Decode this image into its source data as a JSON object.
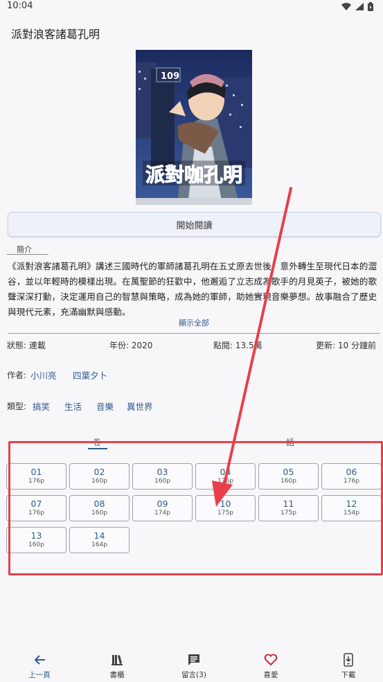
{
  "status": {
    "time": "10:04"
  },
  "title": "派對浪客諸葛孔明",
  "cover": {
    "overlay_text": "派對咖孔明",
    "badge": "109"
  },
  "read_button": "開始閱讀",
  "intro_tab": "簡介",
  "description": "《派對浪客諸葛孔明》講述三國時代的軍師諸葛孔明在五丈原去世後，意外轉生至現代日本的澀谷，並以年輕時的模樣出現。在萬聖節的狂歡中，他邂逅了立志成為歌手的月見英子，被她的歌聲深深打動，決定運用自己的智慧與策略，成為她的軍師，助她實現音樂夢想。故事融合了歷史與現代元素，充滿幽默與感動。",
  "show_all": "顯示全部",
  "info": {
    "status": "狀態: 連載",
    "year": "年份: 2020",
    "views": "點閱: 13.5萬",
    "updated": "更新: 10 分鐘前"
  },
  "author": {
    "label": "作者:",
    "names": [
      "小川亮",
      "四葉夕卜"
    ]
  },
  "genre": {
    "label": "類型:",
    "tags": [
      "搞笑",
      "生活",
      "音樂",
      "異世界"
    ]
  },
  "sections": {
    "volumes": "卷",
    "chapters": "話"
  },
  "chapters": [
    {
      "num": "01",
      "pages": "176p"
    },
    {
      "num": "02",
      "pages": "160p"
    },
    {
      "num": "03",
      "pages": "160p"
    },
    {
      "num": "04",
      "pages": "176p"
    },
    {
      "num": "05",
      "pages": "160p"
    },
    {
      "num": "06",
      "pages": "176p"
    },
    {
      "num": "07",
      "pages": "176p"
    },
    {
      "num": "08",
      "pages": "160p"
    },
    {
      "num": "09",
      "pages": "174p"
    },
    {
      "num": "10",
      "pages": "175p"
    },
    {
      "num": "11",
      "pages": "175p"
    },
    {
      "num": "12",
      "pages": "154p"
    },
    {
      "num": "13",
      "pages": "160p"
    },
    {
      "num": "14",
      "pages": "164p"
    }
  ],
  "nav": {
    "back": "上一頁",
    "shelf": "書櫃",
    "comments": "留言(3)",
    "favorite": "喜愛",
    "download": "下載"
  },
  "colors": {
    "accent": "#2f5a8c",
    "highlight": "#e8404a",
    "favorite": "#c8283c"
  }
}
